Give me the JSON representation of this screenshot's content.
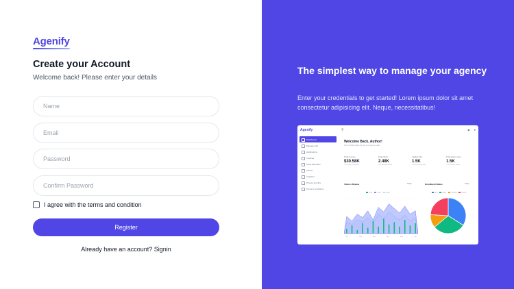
{
  "brand": {
    "name": "Agenify",
    "accent": "#4f46e5"
  },
  "form": {
    "title": "Create your Account",
    "subtitle": "Welcome back! Please enter your details",
    "fields": {
      "name": {
        "placeholder": "Name",
        "value": ""
      },
      "email": {
        "placeholder": "Email",
        "value": ""
      },
      "password": {
        "placeholder": "Password",
        "value": ""
      },
      "confirm": {
        "placeholder": "Confirm Password",
        "value": ""
      }
    },
    "agree_label": "I agree with the terms and condition",
    "agree_checked": false,
    "register_label": "Register",
    "signin_prompt": "Already have an account?",
    "signin_link": "Signin"
  },
  "promo": {
    "title": "The simplest way to manage your agency",
    "description": "Enter your credentials to get started! Lorem ipsum dolor sit amet consectetur adipisicing elit. Neque, necessitatibus!",
    "background": "#4f46e5"
  },
  "mockup": {
    "logo": "Agenify",
    "search_icon": "search-icon",
    "sidebar": [
      {
        "label": "Dashboard",
        "active": true
      },
      {
        "label": "Manage jobs",
        "active": false
      },
      {
        "label": "Applications",
        "active": false
      },
      {
        "label": "Invoices",
        "active": false
      },
      {
        "label": "Team Members",
        "active": false
      },
      {
        "label": "Clients",
        "active": false
      },
      {
        "label": "Analytics",
        "active": false
      },
      {
        "label": "Privacy & policy",
        "active": false
      },
      {
        "label": "Terms & conditions",
        "active": false
      }
    ],
    "welcome": "Welcome Back, Author!",
    "welcome_sub": "Here is what happening with your agency today",
    "stats": [
      {
        "label": "Total revenue",
        "value": "$30.58K",
        "note": "+12% than last month"
      },
      {
        "label": "Total clients",
        "value": "2.48K",
        "note": "+8% than last month"
      },
      {
        "label": "Applied jobs",
        "value": "1.5K",
        "note": "+5% than last month"
      },
      {
        "label": "Total active users",
        "value": "1.5K",
        "note": "+4% than last month"
      }
    ],
    "visitors": {
      "title": "Visitors Review",
      "filter": "Today",
      "legend": [
        {
          "name": "Visits",
          "color": "#10b981"
        },
        {
          "name": "Views",
          "color": "#818cf8"
        },
        {
          "name": "Clicks",
          "color": "#c7d2fe"
        }
      ],
      "x_labels": [
        "Jan",
        "Feb",
        "Mar",
        "Apr",
        "May",
        "Jun"
      ]
    },
    "enrollment": {
      "title": "Enrollment Status",
      "filter": "Today",
      "legend": [
        {
          "name": "New",
          "color": "#3b82f6"
        },
        {
          "name": "Active",
          "color": "#10b981"
        },
        {
          "name": "Pending",
          "color": "#f59e0b"
        },
        {
          "name": "Closed",
          "color": "#f43f5e"
        }
      ]
    }
  },
  "chart_data": [
    {
      "type": "bar",
      "categories": [
        "1",
        "2",
        "3",
        "4",
        "5",
        "6",
        "7",
        "8",
        "9",
        "10",
        "11",
        "12",
        "13",
        "14"
      ],
      "series": [
        {
          "name": "Visits",
          "values": [
            8,
            14,
            6,
            18,
            10,
            22,
            12,
            26,
            16,
            20,
            12,
            24,
            14,
            18
          ]
        }
      ],
      "area_series": [
        {
          "name": "Views",
          "values": [
            30,
            22,
            34,
            28,
            40,
            24,
            46,
            38,
            52,
            44,
            36,
            48,
            34,
            40
          ]
        },
        {
          "name": "Clicks",
          "values": [
            20,
            16,
            24,
            20,
            28,
            18,
            34,
            26,
            38,
            30,
            24,
            32,
            22,
            28
          ]
        }
      ],
      "ylim": [
        0,
        60
      ]
    },
    {
      "type": "pie",
      "labels": [
        "New",
        "Active",
        "Pending",
        "Closed"
      ],
      "values": [
        34,
        30,
        12,
        24
      ],
      "colors": [
        "#3b82f6",
        "#10b981",
        "#f59e0b",
        "#f43f5e"
      ]
    }
  ]
}
